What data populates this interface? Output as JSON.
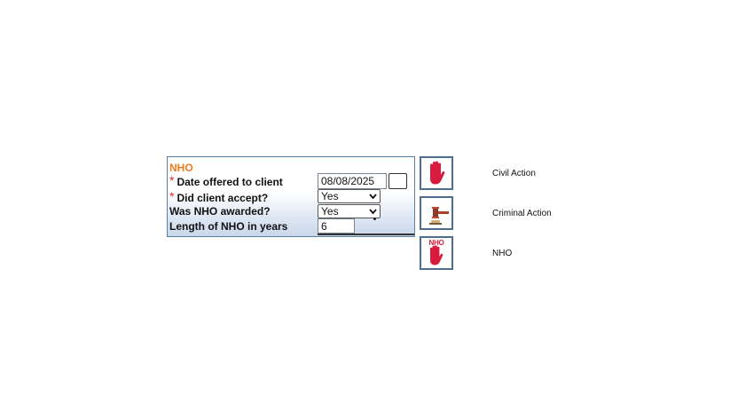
{
  "form": {
    "title": "NHO",
    "required_marker": "*",
    "date_offered_label": "Date offered to client",
    "date_offered_value": "08/08/2025",
    "client_accept_label": "Did client accept?",
    "client_accept_value": "Yes",
    "nho_awarded_label": "Was NHO awarded?",
    "nho_awarded_value": "Yes",
    "length_label": "Length of NHO in years",
    "length_value": "6",
    "dropdown_arrow": "⌄"
  },
  "tiles": [
    {
      "label": "Civil Action",
      "icon": "red-hand-icon"
    },
    {
      "label": "Criminal Action",
      "icon": "gavel-icon"
    },
    {
      "label": "NHO",
      "icon": "nho-hand-icon",
      "badge": "NHO"
    }
  ],
  "colors": {
    "title_orange": "#f07b1c",
    "required_red": "#e0292f",
    "hand_red": "#d81b3c",
    "border_blue": "#4f6e8d"
  }
}
